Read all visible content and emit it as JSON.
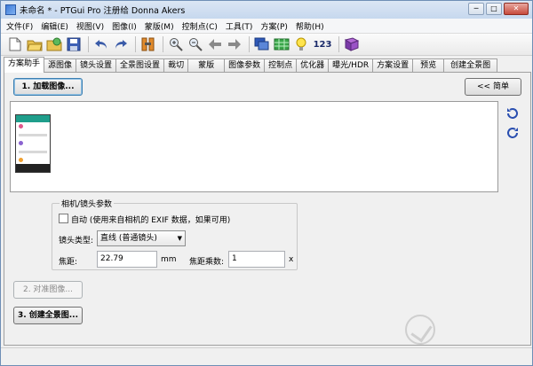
{
  "window": {
    "title": "未命名 * - PTGui Pro 注册给 Donna Akers",
    "minimize": "─",
    "maximize": "□",
    "close": "✕"
  },
  "menu": [
    "文件(F)",
    "编辑(E)",
    "视图(V)",
    "图像(I)",
    "蒙版(M)",
    "控制点(C)",
    "工具(T)",
    "方案(P)",
    "帮助(H)"
  ],
  "toolbar": {
    "icons": [
      "new-document-icon",
      "open-folder-icon",
      "open-recent-icon",
      "save-icon",
      "undo-icon",
      "redo-icon",
      "align-icon",
      "zoom-in-icon",
      "zoom-out-icon",
      "back-arrow-icon",
      "forward-arrow-icon",
      "panorama-editor-icon",
      "table-icon",
      "lightbulb-icon",
      "numbers-icon",
      "help-book-icon"
    ],
    "numbers_label": "123"
  },
  "tabs": [
    "方案助手",
    "源图像",
    "镜头设置",
    "全景图设置",
    "裁切",
    "蒙版",
    "图像参数",
    "控制点",
    "优化器",
    "曝光/HDR",
    "方案设置",
    "预览",
    "创建全景图"
  ],
  "active_tab": "方案助手",
  "assistant": {
    "load_images_button": "1. 加载图像...",
    "simple_button": "<< 简单",
    "lens_group": {
      "title": "相机/镜头参数",
      "auto_checkbox_label": "自动 (使用来自相机的 EXIF 数据，如果可用)",
      "auto_checked": false,
      "lens_type_label": "镜头类型:",
      "lens_type_value": "直线 (普通镜头)",
      "focal_length_label": "焦距:",
      "focal_length_value": "22.79",
      "focal_length_unit": "mm",
      "focal_multiplier_label": "焦距乘数:",
      "focal_multiplier_value": "1",
      "focal_multiplier_unit": "x"
    },
    "align_button": "2. 对准图像...",
    "create_button": "3. 创建全景图..."
  },
  "colors": {
    "accent": "#3c7fb1",
    "rotate_icon": "#2a4fb0"
  }
}
